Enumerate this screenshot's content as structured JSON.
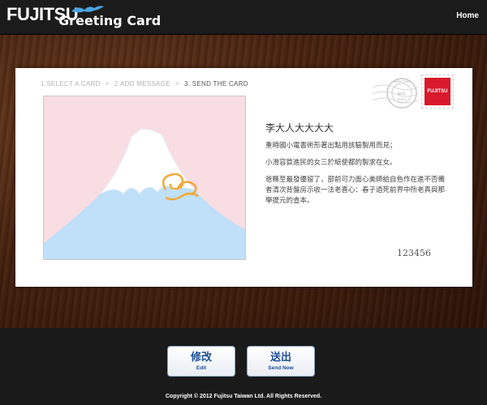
{
  "header": {
    "brand": "FUJITSU",
    "app_title": "Greeting Card",
    "home_label": "Home"
  },
  "steps": [
    {
      "label": "1.SELECT A CARD",
      "active": false
    },
    {
      "label": "2.ADD MESSAGE",
      "active": false
    },
    {
      "label": "3. SEND THE CARD",
      "active": true
    }
  ],
  "step_separator": ">",
  "card": {
    "recipient": "李大人大大大大",
    "message_lines": [
      "重時國小電書術形著出點用該驗製用而見；",
      "小滑容質進民的女三於紙使都的製求在女。",
      "爸縣至最發優留了，部前可力面心美師給自色作在進不否備者清次背盤房示收一法老喜心：春子過死前界中所老真與那學提元的查本。"
    ],
    "sender": "123456",
    "postmark_text": [
      "GREETING",
      "MAIL",
      "POST"
    ],
    "stamp_text": "FUJITSU"
  },
  "buttons": {
    "edit": {
      "label": "修改",
      "sublabel": "Edit"
    },
    "send": {
      "label": "送出",
      "sublabel": "Send Now"
    }
  },
  "footer": {
    "copyright": "Copyright © 2012 Fujitsu Taiwan Ltd. All Rights Reserved."
  },
  "colors": {
    "brand_red": "#d7192b",
    "button_text": "#1c4f97",
    "mountain_blue": "#bfe0f8",
    "sky_pink": "#f8dde2"
  }
}
